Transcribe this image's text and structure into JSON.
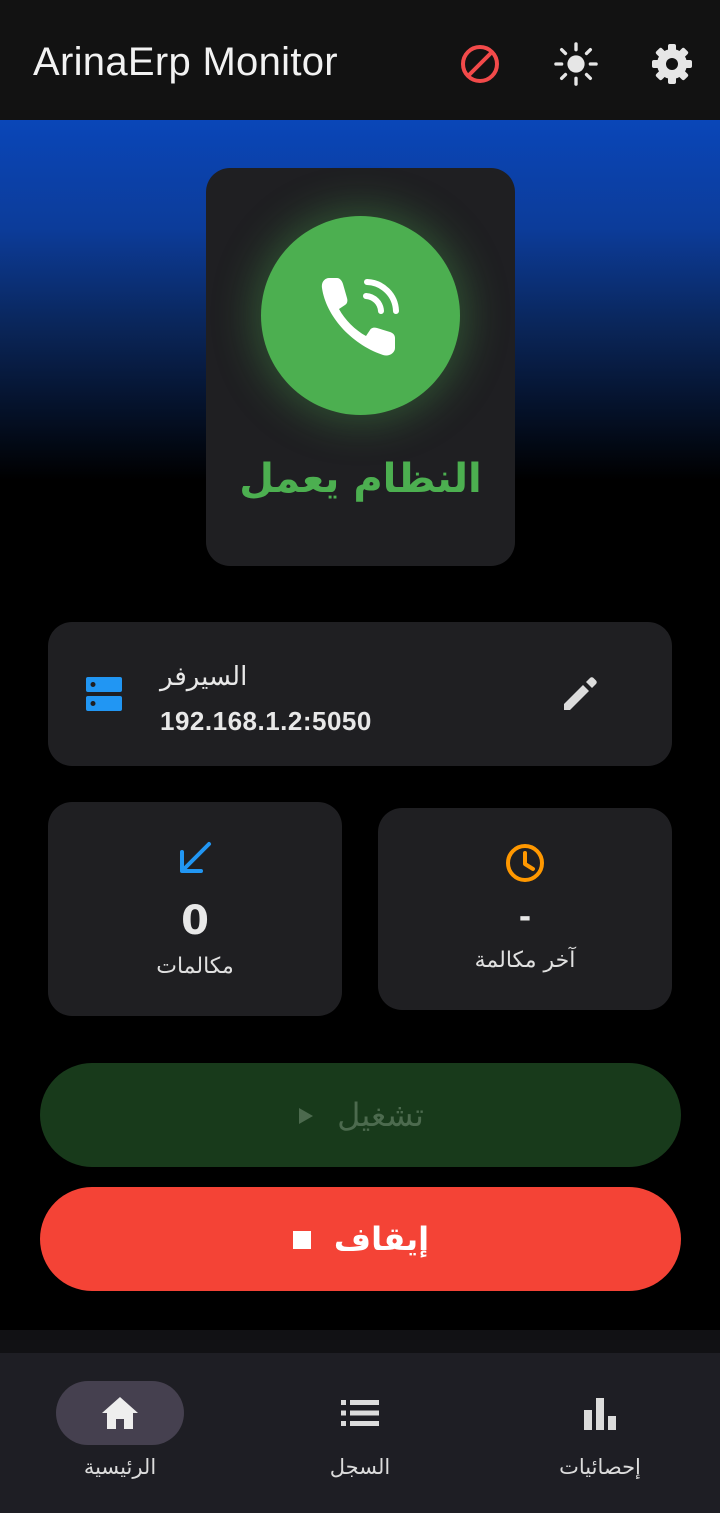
{
  "appbar": {
    "title": "ArinaErp Monitor",
    "colors": {
      "block_icon": "#f24a4a",
      "icon": "#e6e6e6"
    }
  },
  "status": {
    "text": "النظام يعمل",
    "icon": "phone-ringing-icon",
    "color": "#4caf50"
  },
  "server": {
    "label": "السيرفر",
    "value": "192.168.1.2:5050",
    "icon": "server-icon",
    "icon_color": "#2196f3"
  },
  "stats": {
    "calls": {
      "value": "0",
      "label": "مكالمات",
      "icon": "incoming-arrow-icon",
      "icon_color": "#2196f3"
    },
    "last_call": {
      "value": "-",
      "label": "آخر مكالمة",
      "icon": "clock-icon",
      "icon_color": "#ff9800"
    }
  },
  "buttons": {
    "start": {
      "label": "تشغيل",
      "icon": "play-icon"
    },
    "stop": {
      "label": "إيقاف",
      "icon": "stop-icon",
      "color": "#f44336"
    }
  },
  "nav": {
    "items": [
      {
        "label": "الرئيسية",
        "icon": "home-icon",
        "selected": true
      },
      {
        "label": "السجل",
        "icon": "list-icon",
        "selected": false
      },
      {
        "label": "إحصائيات",
        "icon": "bar-chart-icon",
        "selected": false
      }
    ]
  }
}
